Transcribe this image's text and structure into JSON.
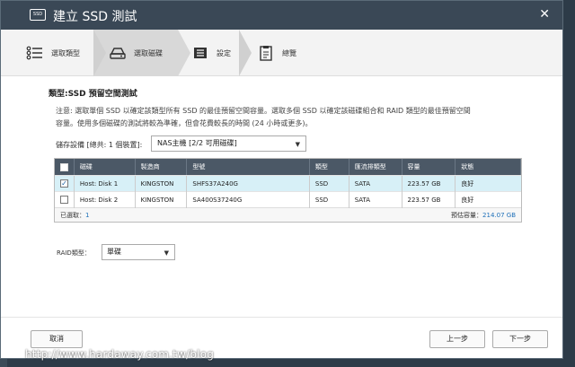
{
  "window": {
    "title": "建立 SSD 測試",
    "icon_label": "SSD",
    "close_glyph": "✕"
  },
  "steps": [
    {
      "label": "選取類型",
      "icon": "list-icon"
    },
    {
      "label": "選取磁碟",
      "icon": "disk-icon",
      "active": true
    },
    {
      "label": "設定",
      "icon": "settings-icon"
    },
    {
      "label": "總覽",
      "icon": "clipboard-icon"
    }
  ],
  "content": {
    "section_title": "類型:SSD 預留空間測試",
    "note_line1": "注意: 選取單個 SSD 以確定該類型所有 SSD 的最佳預留空間容量。選取多個 SSD 以確定該磁碟組合和 RAID 類型的最佳預留空間",
    "note_line2": "容量。使用多個磁碟的測試將較為準確，但會花費較長的時間 (24 小時或更多)。",
    "device_label": "儲存設備 [總共: 1 個裝置]:",
    "device_value": "NAS主機 [2/2 可用磁碟]",
    "raid_label": "RAID類型：",
    "raid_value": "單碟"
  },
  "table": {
    "headers": [
      "磁碟",
      "製造商",
      "型號",
      "類型",
      "匯流排類型",
      "容量",
      "狀態"
    ],
    "rows": [
      {
        "checked": true,
        "cells": [
          "Host: Disk 1",
          "KINGSTON",
          "SHFS37A240G",
          "SSD",
          "SATA",
          "223.57 GB",
          "良好"
        ]
      },
      {
        "checked": false,
        "cells": [
          "Host: Disk 2",
          "KINGSTON",
          "SA400S37240G",
          "SSD",
          "SATA",
          "223.57 GB",
          "良好"
        ]
      }
    ],
    "selected_label": "已選取：",
    "selected_count": "1",
    "capacity_label": "預估容量：",
    "capacity_value": "214.07 GB"
  },
  "buttons": {
    "cancel": "取消",
    "prev": "上一步",
    "next": "下一步"
  },
  "watermark": "http://www.hardaway.com.tw/blog",
  "colors": {
    "titlebar": "#3a4856",
    "table_header": "#4b5866",
    "selected_row": "#d7f0f7",
    "link_blue": "#1d6fb8"
  }
}
